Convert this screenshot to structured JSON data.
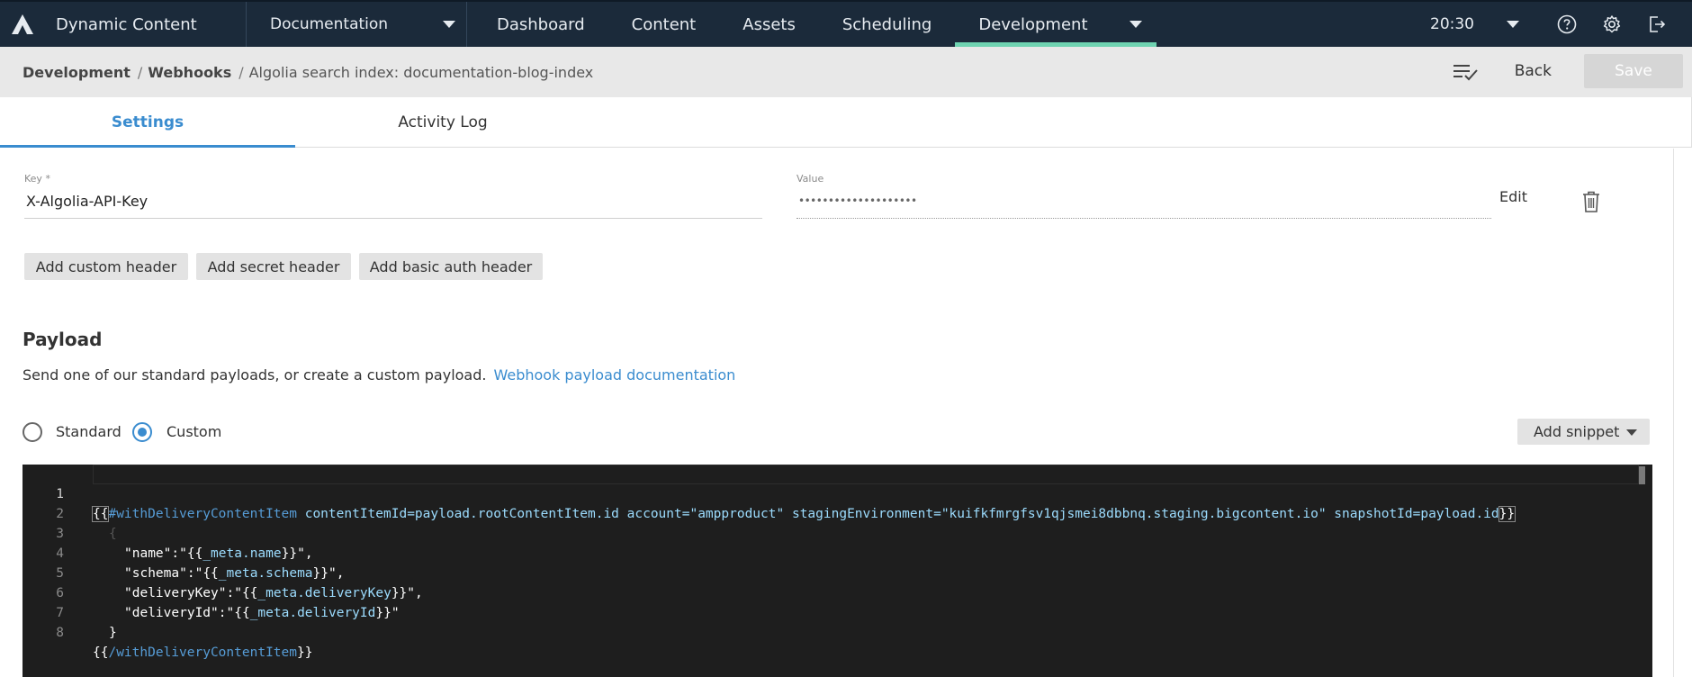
{
  "topnav": {
    "brand": "Dynamic Content",
    "hub": "Documentation",
    "items": [
      "Dashboard",
      "Content",
      "Assets",
      "Scheduling",
      "Development"
    ],
    "time": "20:30"
  },
  "breadcrumb": {
    "items": [
      "Development",
      "Webhooks"
    ],
    "current": "Algolia search index: documentation-blog-index",
    "back": "Back",
    "save": "Save"
  },
  "tabs": [
    "Settings",
    "Activity Log"
  ],
  "header_field": {
    "key_label": "Key *",
    "key_value": "X-Algolia-API-Key",
    "value_label": "Value",
    "value_masked": "••••••••••••••••••••",
    "edit": "Edit"
  },
  "header_buttons": [
    "Add custom header",
    "Add secret header",
    "Add basic auth header"
  ],
  "payload": {
    "title": "Payload",
    "description": "Send one of our standard payloads, or create a custom payload.",
    "link": "Webhook payload documentation",
    "options": [
      "Standard",
      "Custom"
    ],
    "selected": "Custom",
    "add_snippet": "Add snippet"
  },
  "editor": {
    "line_numbers": [
      "1",
      "2",
      "3",
      "4",
      "5",
      "6",
      "7",
      "8"
    ],
    "l1_open": "{{",
    "l1_helper": "#withDeliveryContentItem",
    "l1_args": " contentItemId=payload.rootContentItem.id account=\"ampproduct\" stagingEnvironment=\"kuifkfmrgfsv1qjsmei8dbbnq.staging.bigcontent.io\" snapshotId=payload.id",
    "l1_close": "}}",
    "l2": "{",
    "l3_key": "\"name\":\"",
    "l3_expr": "_meta.name",
    "l4_key": "\"schema\":\"",
    "l4_expr": "_meta.schema",
    "l5_key": "\"deliveryKey\":\"",
    "l5_expr": "_meta.deliveryKey",
    "l6_key": "\"deliveryId\":\"",
    "l6_expr": "_meta.deliveryId",
    "l7": "}",
    "l8_helper": "/withDeliveryContentItem",
    "open": "{{",
    "close": "}}",
    "quote_comma": "\",",
    "quote": "\""
  },
  "colors": {
    "nav_bg": "#1b2a3a",
    "active_underline": "#6fd3b1",
    "accent": "#3a8ccf",
    "editor_bg": "#1e1e1e"
  },
  "icons": [
    "amplience-logo-icon",
    "chevron-down-icon",
    "help-icon",
    "gear-icon",
    "logout-icon",
    "checklist-icon",
    "trash-icon"
  ]
}
